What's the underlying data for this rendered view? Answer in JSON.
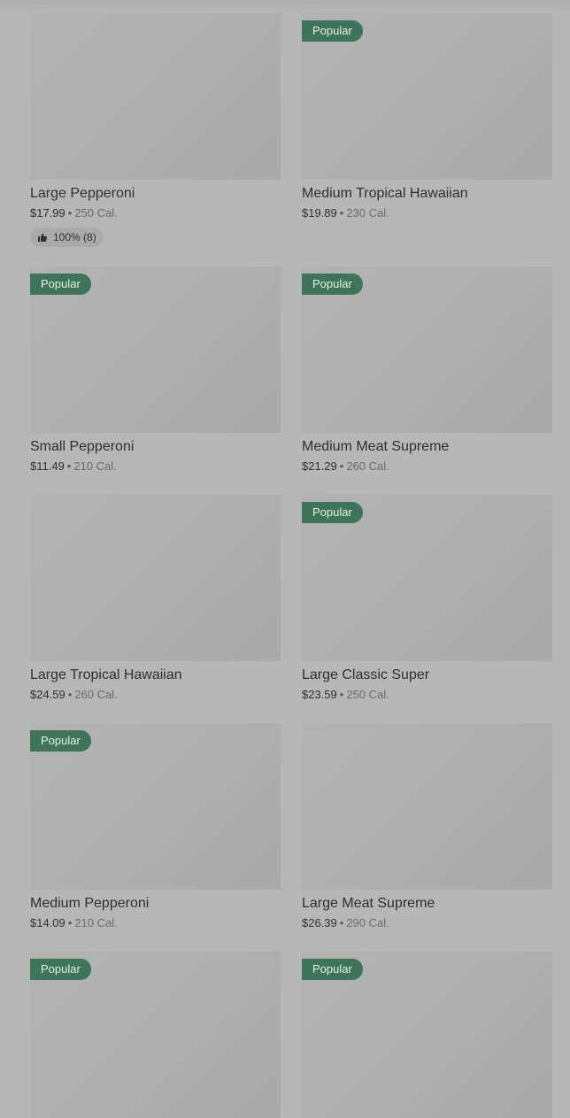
{
  "badge_label": "Popular",
  "colors": {
    "badge": "#3e7459",
    "backdrop": "#b7b7b7"
  },
  "items": [
    {
      "name": "Large Pepperoni",
      "price": "$17.99",
      "calories": "250 Cal.",
      "popular": false,
      "rating": "100% (8)"
    },
    {
      "name": "Medium Tropical Hawaiian",
      "price": "$19.89",
      "calories": "230 Cal.",
      "popular": true
    },
    {
      "name": "Small Pepperoni",
      "price": "$11.49",
      "calories": "210 Cal.",
      "popular": true
    },
    {
      "name": "Medium Meat Supreme",
      "price": "$21.29",
      "calories": "260 Cal.",
      "popular": true
    },
    {
      "name": "Large Tropical Hawaiian",
      "price": "$24.59",
      "calories": "260 Cal.",
      "popular": false
    },
    {
      "name": "Large Classic Super",
      "price": "$23.59",
      "calories": "250 Cal.",
      "popular": true
    },
    {
      "name": "Medium Pepperoni",
      "price": "$14.09",
      "calories": "210 Cal.",
      "popular": true
    },
    {
      "name": "Large Meat Supreme",
      "price": "$26.39",
      "calories": "290 Cal.",
      "popular": false
    },
    {
      "popular": true
    },
    {
      "popular": true
    }
  ],
  "separator": "•",
  "icons": {
    "rating": "thumbs-up-icon"
  }
}
